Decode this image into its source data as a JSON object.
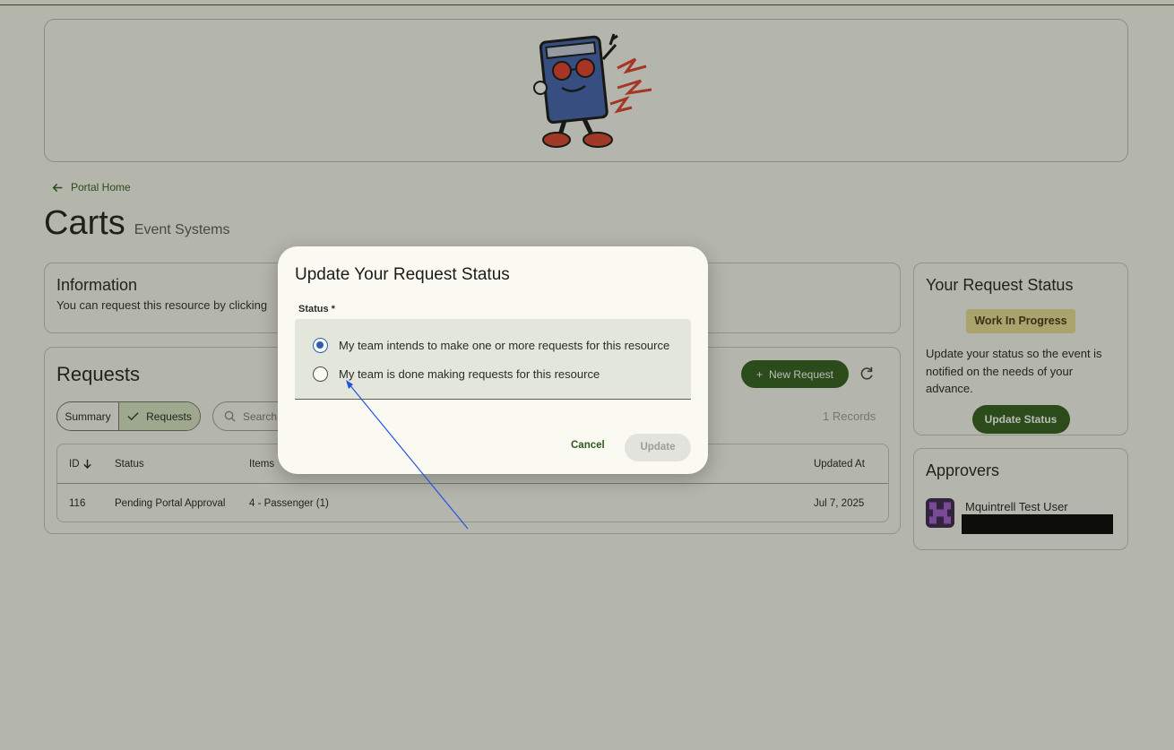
{
  "nav": {
    "back_label": "Portal Home"
  },
  "page": {
    "title": "Carts",
    "subtitle": "Event Systems"
  },
  "information": {
    "title": "Information",
    "text": "You can request this resource by clicking"
  },
  "requests": {
    "title": "Requests",
    "new_request_label": "New Request",
    "segments": [
      "Summary",
      "Requests"
    ],
    "search_placeholder": "Search",
    "records_label": "1 Records",
    "columns": {
      "id": "ID",
      "status": "Status",
      "items": "Items",
      "updated_at": "Updated At"
    },
    "rows": [
      {
        "id": "116",
        "status": "Pending Portal Approval",
        "items": "4 - Passenger (1)",
        "updated_at": "Jul 7, 2025"
      }
    ]
  },
  "request_status": {
    "title": "Your Request Status",
    "badge": "Work In Progress",
    "description": "Update your status so the event is notified on the needs of your advance.",
    "button_label": "Update Status"
  },
  "approvers": {
    "title": "Approvers",
    "items": [
      {
        "name": "Mquintrell Test User"
      }
    ]
  },
  "modal": {
    "title": "Update Your Request Status",
    "field_label": "Status *",
    "options": [
      {
        "label": "My team intends to make one or more requests for this resource",
        "checked": true
      },
      {
        "label": "My team is done making requests for this resource",
        "checked": false
      }
    ],
    "cancel_label": "Cancel",
    "update_label": "Update"
  },
  "colors": {
    "primary": "#2f5b1a",
    "badge": "#e7dc93",
    "radio_selected": "#2d5fb8",
    "annotation_arrow": "#2254e0"
  }
}
